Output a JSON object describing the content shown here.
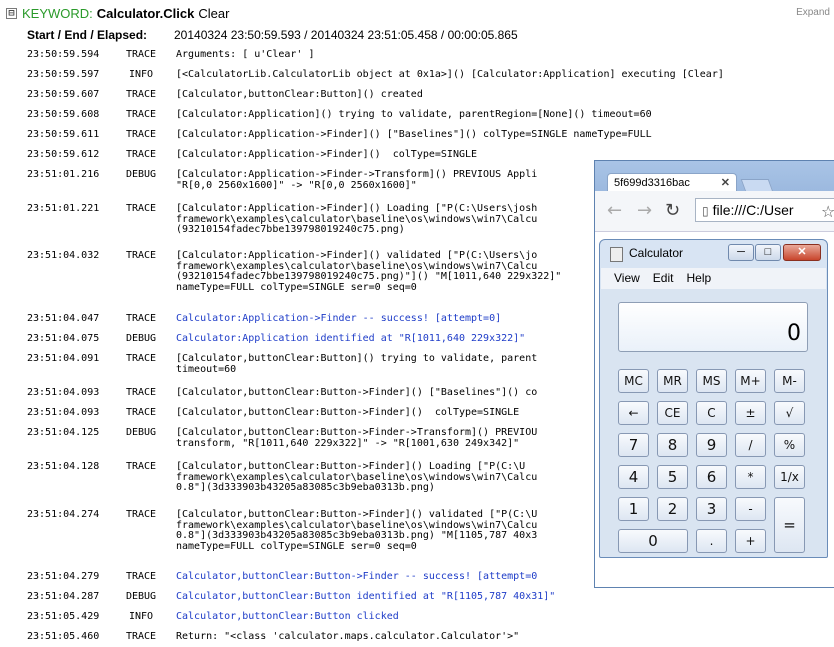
{
  "header": {
    "toggle": "⊟",
    "keyword_label": "KEYWORD:",
    "keyword_name": "Calculator.Click",
    "keyword_arg": "Clear",
    "expand": "Expand"
  },
  "times": {
    "label": "Start / End / Elapsed:",
    "value": "20140324 23:50:59.593 / 20140324 23:51:05.458 / 00:00:05.865"
  },
  "log": [
    {
      "ts": "23:50:59.594",
      "level": "TRACE",
      "lines": [
        "Arguments: [ u'Clear' ]"
      ],
      "blue": false
    },
    {
      "ts": "23:50:59.597",
      "level": "INFO",
      "lines": [
        "[<CalculatorLib.CalculatorLib object at 0x1a>]() [Calculator:Application] executing [Clear]"
      ],
      "blue": false
    },
    {
      "ts": "23:50:59.607",
      "level": "TRACE",
      "lines": [
        "[Calculator,buttonClear:Button]() created"
      ],
      "blue": false
    },
    {
      "ts": "23:50:59.608",
      "level": "TRACE",
      "lines": [
        "[Calculator:Application]() trying to validate, parentRegion=[None]() timeout=60"
      ],
      "blue": false
    },
    {
      "ts": "23:50:59.611",
      "level": "TRACE",
      "lines": [
        "[Calculator:Application->Finder]() [\"Baselines\"]() colType=SINGLE nameType=FULL"
      ],
      "blue": false
    },
    {
      "ts": "23:50:59.612",
      "level": "TRACE",
      "lines": [
        "[Calculator:Application->Finder]()  colType=SINGLE"
      ],
      "blue": false
    },
    {
      "ts": "23:51:01.216",
      "level": "DEBUG",
      "lines": [
        "[Calculator:Application->Finder->Transform]() PREVIOUS Appli",
        "\"R[0,0 2560x1600]\" -> \"R[0,0 2560x1600]\""
      ],
      "blue": false
    },
    {
      "ts": "23:51:01.221",
      "level": "TRACE",
      "lines": [
        "[Calculator:Application->Finder]() Loading [\"P(C:\\Users\\josh",
        "framework\\examples\\calculator\\baseline\\os\\windows\\win7\\Calcu",
        "(93210154fadec7bbe139798019240c75.png)"
      ],
      "blue": false
    },
    {
      "ts": "23:51:04.032",
      "level": "TRACE",
      "lines": [
        "[Calculator:Application->Finder]() validated [\"P(C:\\Users\\jo",
        "framework\\examples\\calculator\\baseline\\os\\windows\\win7\\Calcu",
        "(93210154fadec7bbe139798019240c75.png)\"]() \"M[1011,640 229x322]\"",
        "nameType=FULL colType=SINGLE ser=0 seq=0"
      ],
      "blue": false
    },
    {
      "ts": "23:51:04.047",
      "level": "TRACE",
      "lines": [
        "Calculator:Application->Finder -- success! [attempt=0]"
      ],
      "blue": true
    },
    {
      "ts": "23:51:04.075",
      "level": "DEBUG",
      "lines": [
        "Calculator:Application identified at \"R[1011,640 229x322]\""
      ],
      "blue": true
    },
    {
      "ts": "23:51:04.091",
      "level": "TRACE",
      "lines": [
        "[Calculator,buttonClear:Button]() trying to validate, parent",
        "timeout=60"
      ],
      "blue": false
    },
    {
      "ts": "23:51:04.093",
      "level": "TRACE",
      "lines": [
        "[Calculator,buttonClear:Button->Finder]() [\"Baselines\"]() co"
      ],
      "blue": false
    },
    {
      "ts": "23:51:04.093",
      "level": "TRACE",
      "lines": [
        "[Calculator,buttonClear:Button->Finder]()  colType=SINGLE"
      ],
      "blue": false
    },
    {
      "ts": "23:51:04.125",
      "level": "DEBUG",
      "lines": [
        "[Calculator,buttonClear:Button->Finder->Transform]() PREVIOU",
        "transform, \"R[1011,640 229x322]\" -> \"R[1001,630 249x342]\""
      ],
      "blue": false
    },
    {
      "ts": "23:51:04.128",
      "level": "TRACE",
      "lines": [
        "[Calculator,buttonClear:Button->Finder]() Loading [\"P(C:\\U",
        "framework\\examples\\calculator\\baseline\\os\\windows\\win7\\Calcu",
        "0.8\"](3d333903b43205a83085c3b9eba0313b.png)"
      ],
      "blue": false
    },
    {
      "ts": "23:51:04.274",
      "level": "TRACE",
      "lines": [
        "[Calculator,buttonClear:Button->Finder]() validated [\"P(C:\\U",
        "framework\\examples\\calculator\\baseline\\os\\windows\\win7\\Calcu",
        "0.8\"](3d333903b43205a83085c3b9eba0313b.png) \"M[1105,787 40x3",
        "nameType=FULL colType=SINGLE ser=0 seq=0"
      ],
      "blue": false
    },
    {
      "ts": "23:51:04.279",
      "level": "TRACE",
      "lines": [
        "Calculator,buttonClear:Button->Finder -- success! [attempt=0"
      ],
      "blue": true
    },
    {
      "ts": "23:51:04.287",
      "level": "DEBUG",
      "lines": [
        "Calculator,buttonClear:Button identified at \"R[1105,787 40x31]\""
      ],
      "blue": true
    },
    {
      "ts": "23:51:05.429",
      "level": "INFO",
      "lines": [
        "Calculator,buttonClear:Button clicked"
      ],
      "blue": true
    },
    {
      "ts": "23:51:05.460",
      "level": "TRACE",
      "lines": [
        "Return: \"<class 'calculator.maps.calculator.Calculator'>\""
      ],
      "blue": false
    }
  ],
  "browser": {
    "tab_title": "5f699d3316bac",
    "tab_close": "✕",
    "back": "←",
    "forward": "→",
    "reload": "↻",
    "address": "file:///C:/User",
    "star": "☆"
  },
  "calculator": {
    "title": "Calculator",
    "minimize": "─",
    "maximize": "□",
    "close": "✕",
    "menu": [
      "View",
      "Edit",
      "Help"
    ],
    "display": "0",
    "keys": [
      "MC",
      "MR",
      "MS",
      "M+",
      "M-",
      "←",
      "CE",
      "C",
      "±",
      "√",
      "7",
      "8",
      "9",
      "/",
      "%",
      "4",
      "5",
      "6",
      "*",
      "1/x",
      "1",
      "2",
      "3",
      "-",
      "=",
      "0",
      ".",
      "+"
    ]
  }
}
